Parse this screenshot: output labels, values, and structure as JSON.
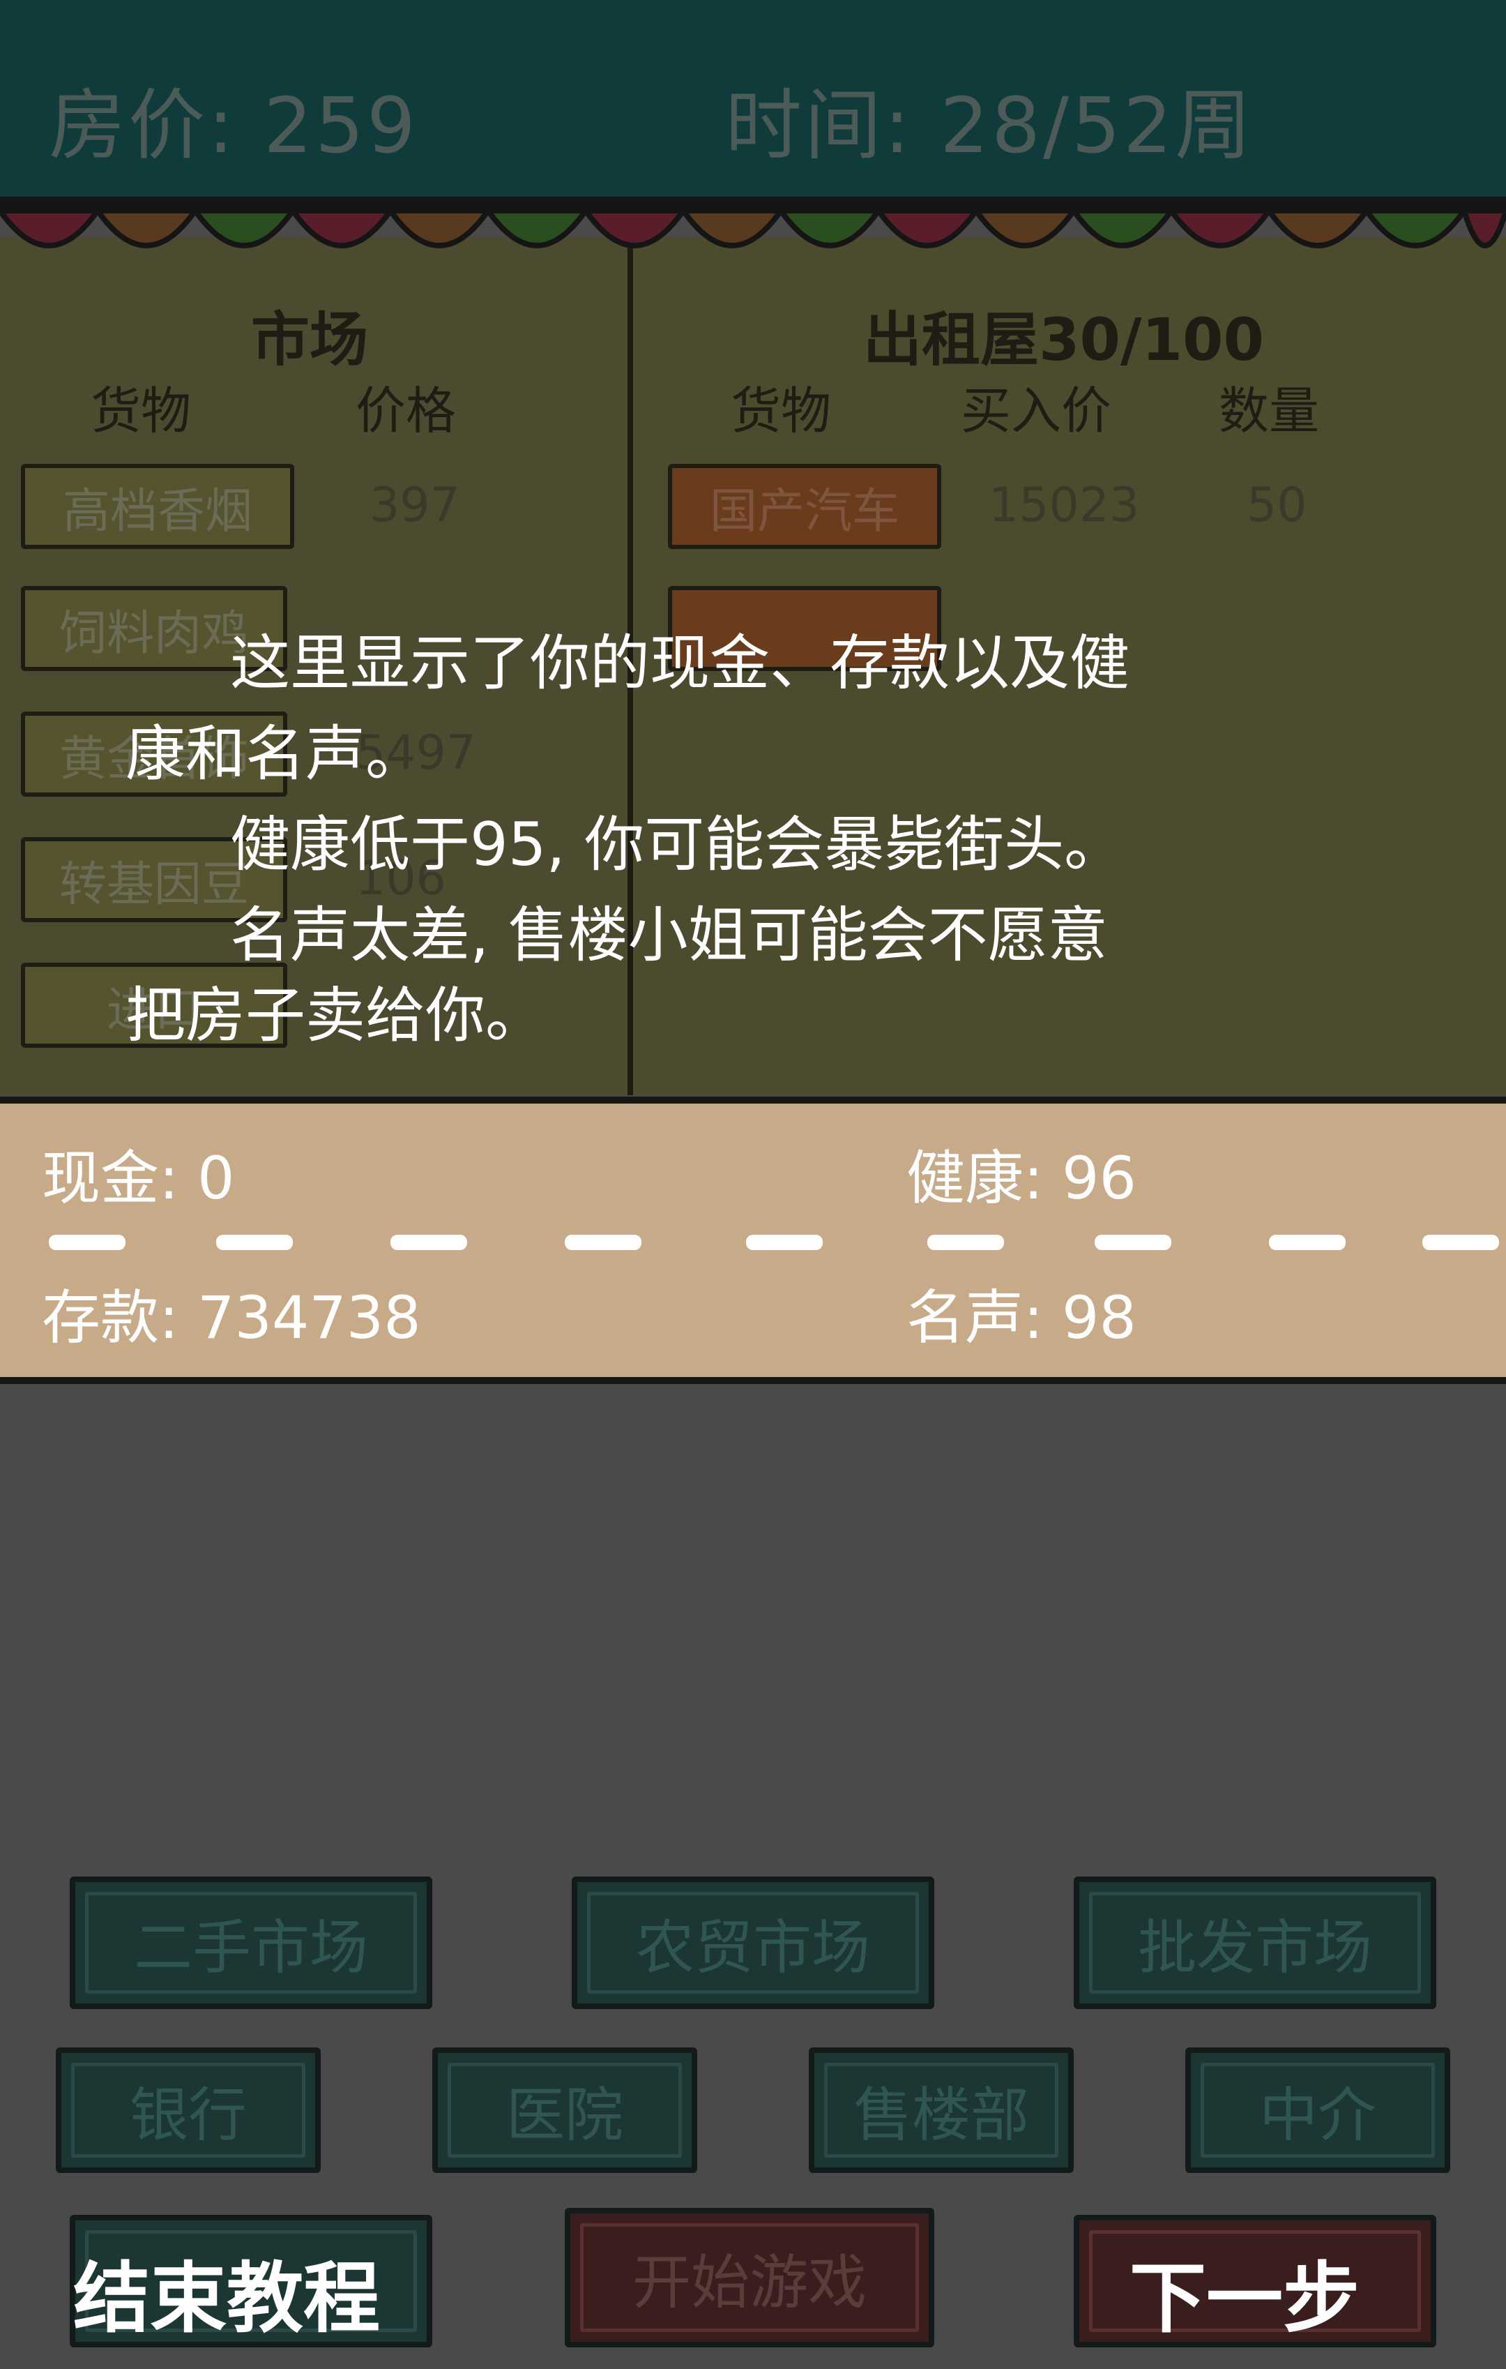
{
  "header": {
    "house_price": "房价: 259",
    "time": "时间: 28/52周"
  },
  "market": {
    "title": "市场",
    "col_goods": "货物",
    "col_price": "价格",
    "items": [
      {
        "name": "高档香烟",
        "price": "397"
      },
      {
        "name": "饲料肉鸡",
        "price": ""
      },
      {
        "name": "黄金首饰",
        "price": "5497"
      },
      {
        "name": "转基因豆",
        "price": "106"
      },
      {
        "name": "进口",
        "price": ""
      }
    ]
  },
  "rental": {
    "title": "出租屋30/100",
    "col_goods": "货物",
    "col_buy": "买入价",
    "col_qty": "数量",
    "items": [
      {
        "name": "国产汽车",
        "buy": "15023",
        "qty": "50"
      },
      {
        "name": "",
        "buy": "",
        "qty": ""
      }
    ]
  },
  "tooltip": {
    "line1": "这里显示了你的现金、存款以及健",
    "line2": "康和名声。",
    "line3": "健康低于95, 你可能会暴毙街头。",
    "line4": "名声太差, 售楼小姐可能会不愿意",
    "line5": "把房子卖给你。"
  },
  "stats": {
    "cash": "现金: 0",
    "health": "健康: 96",
    "deposit": "存款: 734738",
    "reputation": "名声: 98"
  },
  "buttons": {
    "second_hand": "二手市场",
    "farmers": "农贸市场",
    "wholesale": "批发市场",
    "bank": "银行",
    "hospital": "医院",
    "sales": "售楼部",
    "agent": "中介",
    "start_game": "开始游戏",
    "end_tutorial": "结束教程",
    "next_step": "下一步"
  },
  "colors": {
    "top_bar": "#0f3b3b",
    "market_bg": "#4c4a2f",
    "stats_bg": "#c7ab88",
    "button_bg": "#1c3634"
  }
}
